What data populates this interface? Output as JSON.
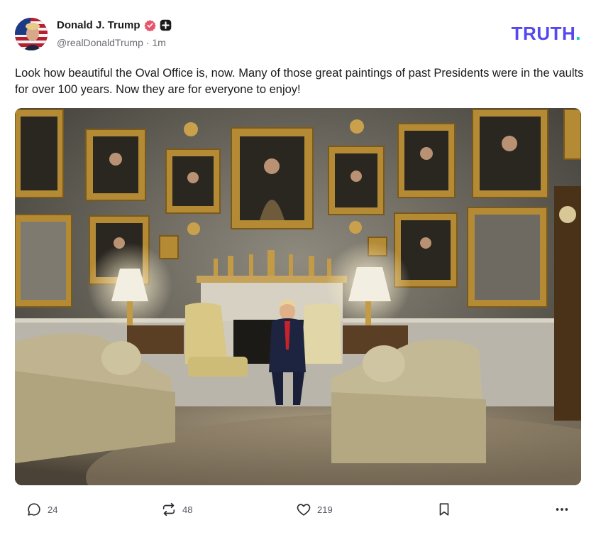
{
  "author": {
    "name": "Donald J. Trump",
    "handle": "@realDonaldTrump",
    "separator": " · ",
    "time": "1m"
  },
  "brand": {
    "logo_text": "TRUTH",
    "logo_dot": "."
  },
  "post": {
    "text": "Look how beautiful the Oval Office is, now. Many of those great paintings of past Presidents were in the vaults for over 100 years. Now they are for everyone to enjoy!"
  },
  "actions": {
    "replies": "24",
    "retruths": "48",
    "likes": "219"
  },
  "icons": {
    "verified": "verified-badge-icon",
    "plus": "plus-badge-icon",
    "reply": "comment-bubble-icon",
    "retruth": "retruth-arrows-icon",
    "like": "heart-icon",
    "bookmark": "bookmark-icon",
    "more": "more-dots-icon"
  },
  "colors": {
    "brand_purple": "#5448ee",
    "brand_teal": "#00d6c0",
    "verified_pink": "#e8546a",
    "muted_text": "#6b6b73"
  }
}
